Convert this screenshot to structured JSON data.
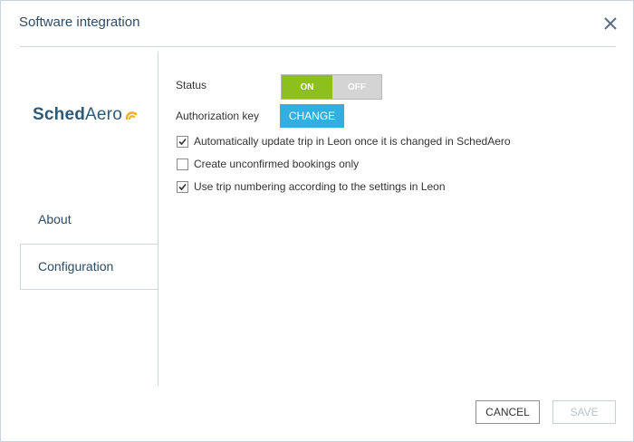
{
  "dialog": {
    "title": "Software integration",
    "close_icon": "close-icon"
  },
  "sidebar": {
    "logo": {
      "bold": "Sched",
      "light": "Aero",
      "mark_icon": "arc-logo-mark",
      "mark_color": "#f1b21a"
    },
    "items": [
      {
        "label": "About",
        "active": false
      },
      {
        "label": "Configuration",
        "active": true
      }
    ]
  },
  "config": {
    "status_label": "Status",
    "status_on": "ON",
    "status_off": "OFF",
    "status_value": "ON",
    "auth_label": "Authorization key",
    "change_label": "CHANGE",
    "options": [
      {
        "label": "Automatically update trip in Leon once it is changed in SchedAero",
        "checked": true
      },
      {
        "label": "Create unconfirmed bookings only",
        "checked": false
      },
      {
        "label": "Use trip numbering according to the settings in Leon",
        "checked": true
      }
    ]
  },
  "footer": {
    "cancel_label": "CANCEL",
    "save_label": "SAVE"
  },
  "colors": {
    "accent": "#33aee0",
    "on_green": "#8dbf1d",
    "title": "#2f4b63",
    "logo": "#2e5a79"
  }
}
